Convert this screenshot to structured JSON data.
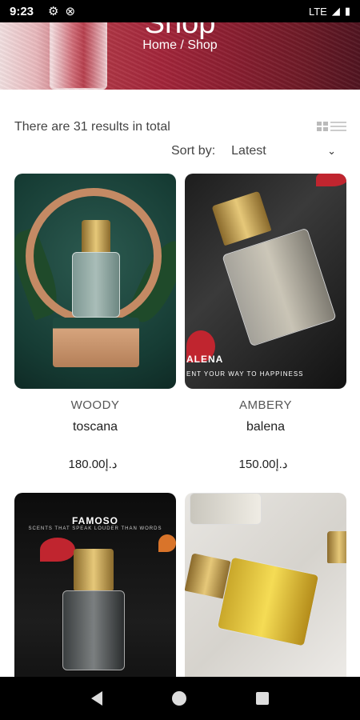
{
  "status_bar": {
    "time": "9:23",
    "network": "LTE"
  },
  "hero": {
    "title": "Shop",
    "breadcrumb": "Home / Shop"
  },
  "results_text": "There are 31 results in total",
  "sort": {
    "label": "Sort by:",
    "value": "Latest"
  },
  "products": [
    {
      "category": "WOODY",
      "name": "toscana",
      "currency": "د.إ",
      "price": "180.00",
      "label": "Toscana"
    },
    {
      "category": "AMBERY",
      "name": "balena",
      "currency": "د.إ",
      "price": "150.00",
      "brand": "ALENA",
      "tagline": "ENT YOUR WAY TO HAPPINESS"
    },
    {
      "brand": "FAMOSO",
      "tagline": "SCENTS THAT SPEAK LOUDER THAN WORDS"
    },
    {}
  ]
}
